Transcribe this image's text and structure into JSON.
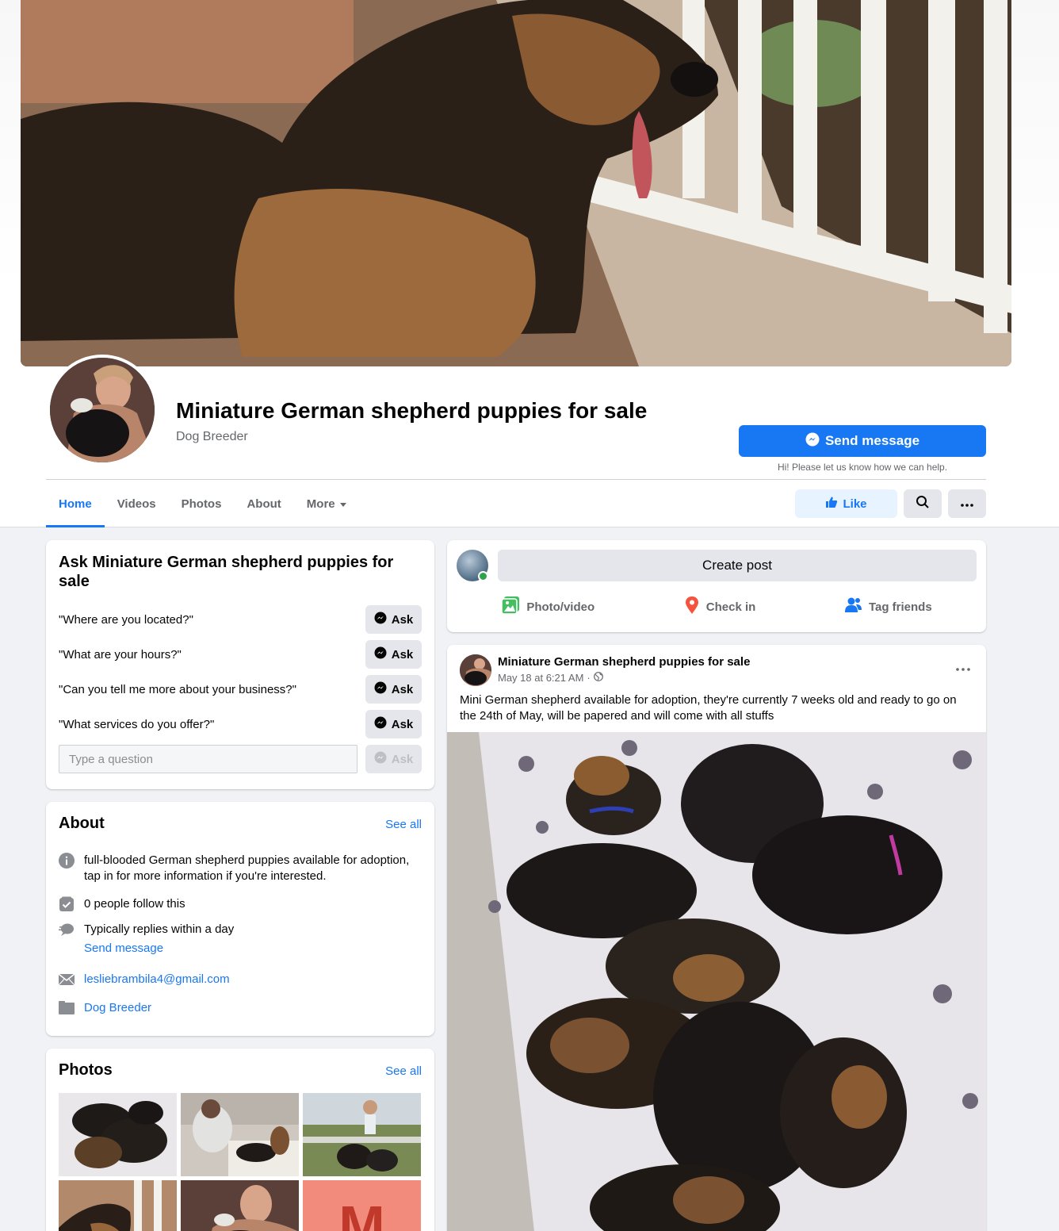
{
  "page": {
    "name": "Miniature German shepherd puppies for sale",
    "category": "Dog Breeder",
    "send_message": "Send message",
    "send_hint": "Hi! Please let us know how we can help."
  },
  "tabs": [
    {
      "label": "Home",
      "active": true
    },
    {
      "label": "Videos"
    },
    {
      "label": "Photos"
    },
    {
      "label": "About"
    },
    {
      "label": "More"
    }
  ],
  "actions": {
    "like": "Like",
    "search_icon": "search-icon",
    "more_icon": "ellipsis-icon"
  },
  "ask": {
    "title": "Ask Miniature German shepherd puppies for sale",
    "questions": [
      "\"Where are you located?\"",
      "\"What are your hours?\"",
      "\"Can you tell me more about your business?\"",
      "\"What services do you offer?\""
    ],
    "button_label": "Ask",
    "input_placeholder": "Type a question"
  },
  "about": {
    "title": "About",
    "see_all": "See all",
    "description": "full-blooded German shepherd puppies available for adoption, tap in for more information if you're interested.",
    "followers": "0 people follow this",
    "replies": "Typically replies within a day",
    "send_message": "Send message",
    "email": "lesliebrambila4@gmail.com",
    "category": "Dog Breeder"
  },
  "photos": {
    "title": "Photos",
    "see_all": "See all",
    "tile_letter": "M"
  },
  "composer": {
    "create_post": "Create post",
    "photo_video": "Photo/video",
    "check_in": "Check in",
    "tag_friends": "Tag friends"
  },
  "post": {
    "author": "Miniature German shepherd puppies for sale",
    "timestamp": "May 18 at 6:21 AM",
    "separator": "·",
    "text": "Mini German shepherd available for adoption, they're currently 7 weeks old and ready to go on the 24th of May, will be papered and will come with all stuffs"
  },
  "colors": {
    "brand_blue": "#1877f2",
    "background": "#f0f2f5",
    "secondary_text": "#65676b",
    "online_green": "#31a24c"
  }
}
